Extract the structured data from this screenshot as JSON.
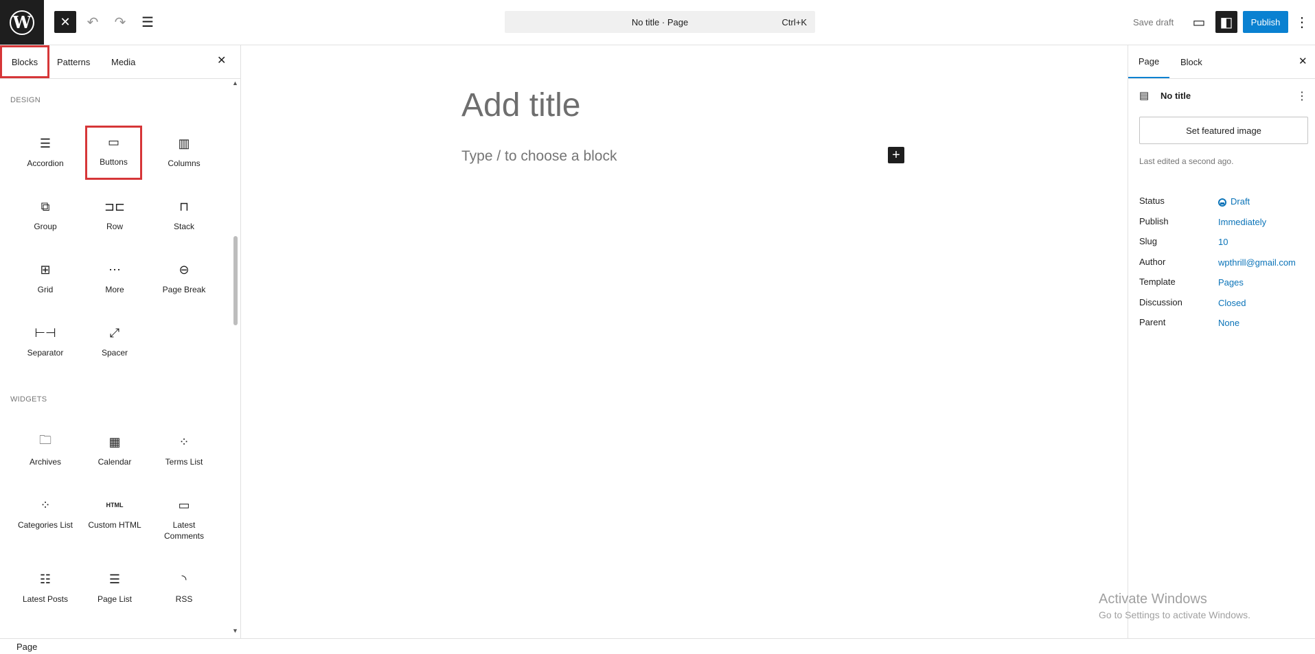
{
  "topbar": {
    "logo": "W",
    "close_icon": "✕",
    "undo_icon": "↶",
    "redo_icon": "↷",
    "list_icon": "☰",
    "command": {
      "title": "No title · Page",
      "shortcut": "Ctrl+K"
    },
    "save_draft": "Save draft",
    "view_icon": "▭",
    "settings_icon": "◧",
    "publish": "Publish",
    "more_icon": "⋮"
  },
  "inserter": {
    "tabs": [
      "Blocks",
      "Patterns",
      "Media"
    ],
    "close_icon": "✕",
    "categories": [
      {
        "label": "DESIGN",
        "blocks": [
          {
            "label": "Accordion",
            "icon": "☰"
          },
          {
            "label": "Buttons",
            "icon": "▭"
          },
          {
            "label": "Columns",
            "icon": "▥"
          },
          {
            "label": "Group",
            "icon": "⧉"
          },
          {
            "label": "Row",
            "icon": "⊐⊏"
          },
          {
            "label": "Stack",
            "icon": "⊓"
          },
          {
            "label": "Grid",
            "icon": "⊞"
          },
          {
            "label": "More",
            "icon": "⋯"
          },
          {
            "label": "Page Break",
            "icon": "⊖"
          },
          {
            "label": "Separator",
            "icon": "⊢⊣"
          },
          {
            "label": "Spacer",
            "icon": "⤢"
          }
        ]
      },
      {
        "label": "WIDGETS",
        "blocks": [
          {
            "label": "Archives",
            "icon": "🗀"
          },
          {
            "label": "Calendar",
            "icon": "▦"
          },
          {
            "label": "Terms List",
            "icon": "⁘"
          },
          {
            "label": "Categories List",
            "icon": "⁘"
          },
          {
            "label": "Custom HTML",
            "icon": "HTML"
          },
          {
            "label": "Latest Comments",
            "icon": "▭"
          },
          {
            "label": "Latest Posts",
            "icon": "☷"
          },
          {
            "label": "Page List",
            "icon": "☰"
          },
          {
            "label": "RSS",
            "icon": "◝"
          }
        ]
      }
    ]
  },
  "canvas": {
    "title_placeholder": "Add title",
    "block_placeholder": "Type / to choose a block",
    "plus_icon": "+"
  },
  "sidebar": {
    "tabs": [
      "Page",
      "Block"
    ],
    "close_icon": "✕",
    "doc_icon": "▤",
    "doc_title": "No title",
    "doc_more": "⋮",
    "featured_image": "Set featured image",
    "last_edited": "Last edited a second ago.",
    "meta": [
      {
        "key": "Status",
        "value": "Draft"
      },
      {
        "key": "Publish",
        "value": "Immediately"
      },
      {
        "key": "Slug",
        "value": "10"
      },
      {
        "key": "Author",
        "value": "wpthrill@gmail.com"
      },
      {
        "key": "Template",
        "value": "Pages"
      },
      {
        "key": "Discussion",
        "value": "Closed"
      },
      {
        "key": "Parent",
        "value": "None"
      }
    ]
  },
  "watermark": {
    "line1": "Activate Windows",
    "line2": "Go to Settings to activate Windows."
  },
  "footer": {
    "breadcrumb": "Page"
  },
  "colors": {
    "accent": "#0a81d1",
    "highlight": "#d63638",
    "dark": "#1e1e1e"
  }
}
